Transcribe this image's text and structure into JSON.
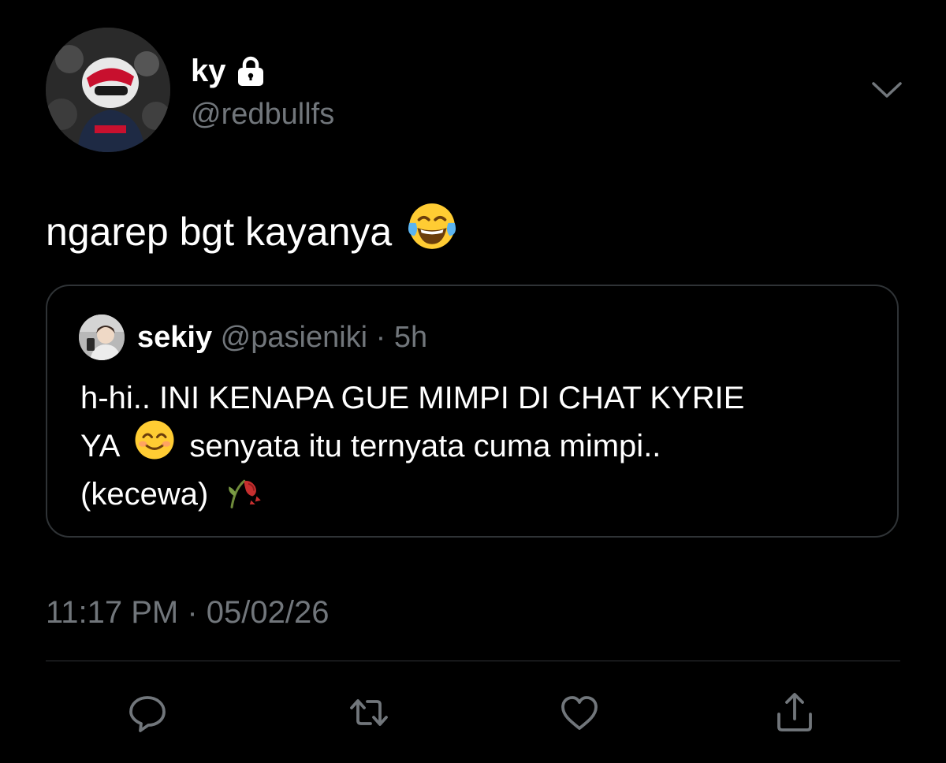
{
  "tweet": {
    "author": {
      "display_name": "ky",
      "handle": "@redbullfs",
      "avatar_icon": "profile-photo",
      "protected_icon": "lock-icon"
    },
    "menu_icon": "chevron-down-icon",
    "text": "ngarep bgt kayanya",
    "text_emoji": "face-with-tears-of-joy",
    "quoted": {
      "display_name": "sekiy",
      "handle": "@pasieniki",
      "separator": "·",
      "time": "5h",
      "lines": [
        {
          "a": "h-hi.. INI KENAPA GUE MIMPI DI CHAT KYRIE",
          "emoji": "",
          "b": ""
        },
        {
          "a": "YA",
          "emoji": "smiling-face-with-smiling-eyes",
          "b": "senyata itu ternyata cuma mimpi.."
        },
        {
          "a": "(kecewa)",
          "emoji": "wilted-flower",
          "b": ""
        }
      ]
    },
    "timestamp": "11:17 PM · 05/02/26",
    "actions": [
      {
        "name": "reply",
        "icon": "speech-bubble-icon"
      },
      {
        "name": "retweet",
        "icon": "retweet-icon"
      },
      {
        "name": "like",
        "icon": "heart-icon"
      },
      {
        "name": "share",
        "icon": "share-icon"
      }
    ]
  },
  "colors": {
    "background": "#000000",
    "text_primary": "#ffffff",
    "text_secondary": "#71767b",
    "border": "#2f3336"
  }
}
